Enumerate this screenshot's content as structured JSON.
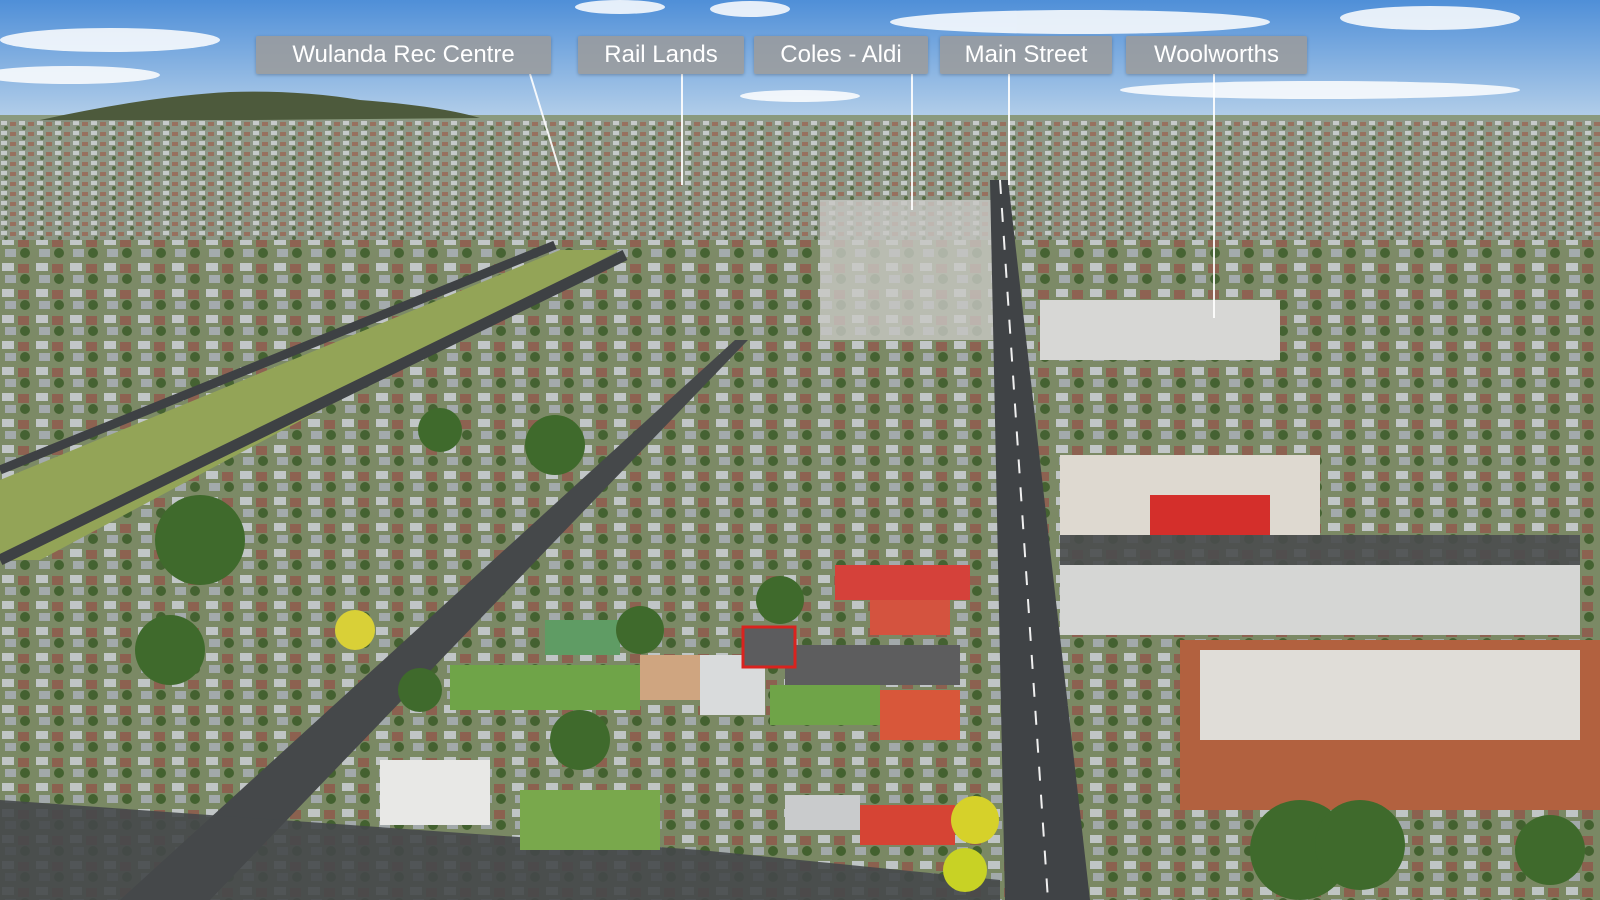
{
  "photo": {
    "subject": "aerial-town-view",
    "highlight_color": "#d9231f"
  },
  "labels": [
    {
      "id": "wulanda",
      "text": "Wulanda Rec Centre"
    },
    {
      "id": "rail",
      "text": "Rail Lands"
    },
    {
      "id": "coles",
      "text": "Coles - Aldi"
    },
    {
      "id": "main",
      "text": "Main Street"
    },
    {
      "id": "woolworths",
      "text": "Woolworths"
    }
  ]
}
